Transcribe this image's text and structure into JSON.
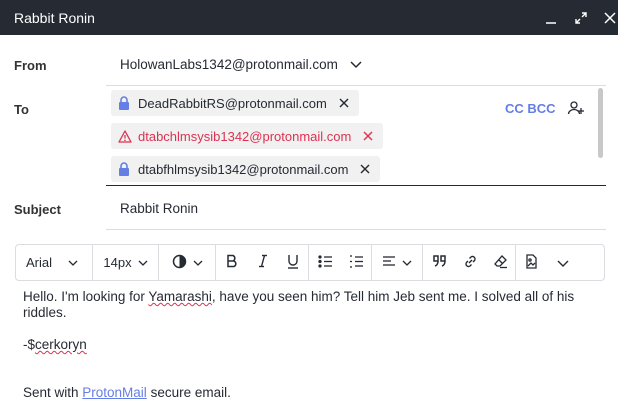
{
  "window": {
    "title": "Rabbit Ronin"
  },
  "from": {
    "label": "From",
    "address": "HolowanLabs1342@protonmail.com"
  },
  "to": {
    "label": "To",
    "recipients": [
      {
        "address": "DeadRabbitRS@protonmail.com",
        "status": "secure",
        "icon": "lock-icon"
      },
      {
        "address": "dtabchlmsysib1342@protonmail.com",
        "status": "error",
        "icon": "warning-icon"
      },
      {
        "address": "dtabfhlmsysib1342@protonmail.com",
        "status": "secure",
        "icon": "lock-icon"
      }
    ],
    "cc_bcc_label": "CC BCC"
  },
  "subject": {
    "label": "Subject",
    "value": "Rabbit Ronin"
  },
  "toolbar": {
    "font_family": "Arial",
    "font_size": "14px"
  },
  "message": {
    "line1_a": "Hello.  I'm looking for ",
    "line1_b": "Yamarashi",
    "line1_c": ", have you seen him?  Tell him Jeb sent me.  I solved all of his riddles.",
    "sig_a": "-$",
    "sig_b": "cerkoryn",
    "footer_a": "Sent with ",
    "footer_link": "ProtonMail",
    "footer_b": " secure email."
  },
  "colors": {
    "titlebar": "#262a33",
    "accent": "#657ee4",
    "error": "#dc3251"
  }
}
